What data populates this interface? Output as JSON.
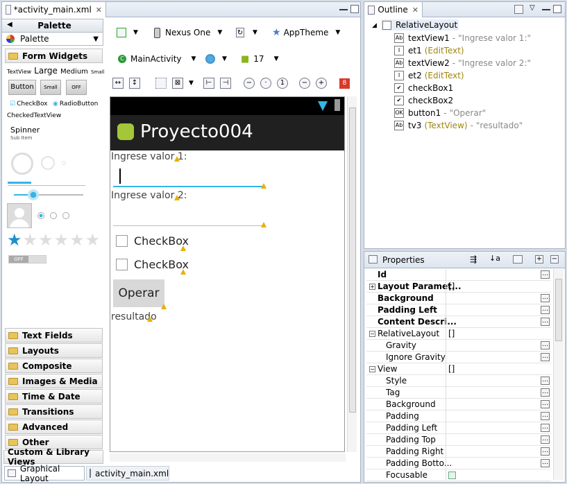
{
  "editor": {
    "tab_title": "*activity_main.xml",
    "bottom_tabs": [
      "Graphical Layout",
      "activity_main.xml"
    ]
  },
  "palette": {
    "header": "Palette",
    "dropdown": "Palette",
    "section": "Form Widgets",
    "tv_sizes": [
      "TextView",
      "Large",
      "Medium",
      "Small"
    ],
    "buttons": [
      "Button",
      "Small",
      "OFF"
    ],
    "check": "CheckBox",
    "radio": "RadioButton",
    "checked_tv": "CheckedTextView",
    "spinner": "Spinner",
    "spinner_sub": "Sub Item",
    "switch": "OFF",
    "categories": [
      "Text Fields",
      "Layouts",
      "Composite",
      "Images & Media",
      "Time & Date",
      "Transitions",
      "Advanced",
      "Other"
    ],
    "custom": "Custom & Library Views"
  },
  "toolbar": {
    "device": "Nexus One",
    "theme": "AppTheme",
    "activity": "MainActivity",
    "api": "17",
    "error_count": "8"
  },
  "app": {
    "title": "Proyecto004",
    "label1": "Ingrese valor 1:",
    "label2": "Ingrese valor 2:",
    "check1": "CheckBox",
    "check2": "CheckBox",
    "button": "Operar",
    "result": "resultado"
  },
  "outline": {
    "title": "Outline",
    "root": "RelativeLayout",
    "items": [
      {
        "icon": "Ab",
        "name": "textView1",
        "type": "",
        "value": "\"Ingrese valor 1:\""
      },
      {
        "icon": "I",
        "name": "et1",
        "type": "(EditText)",
        "value": ""
      },
      {
        "icon": "Ab",
        "name": "textView2",
        "type": "",
        "value": "\"Ingrese valor 2:\""
      },
      {
        "icon": "I",
        "name": "et2",
        "type": "(EditText)",
        "value": ""
      },
      {
        "icon": "✔",
        "name": "checkBox1",
        "type": "",
        "value": ""
      },
      {
        "icon": "✔",
        "name": "checkBox2",
        "type": "",
        "value": ""
      },
      {
        "icon": "OK",
        "name": "button1",
        "type": "",
        "value": "\"Operar\""
      },
      {
        "icon": "Ab",
        "name": "tv3",
        "type": "(TextView)",
        "value": "\"resultado\""
      }
    ]
  },
  "properties": {
    "title": "Properties",
    "rows": [
      {
        "name": "Id",
        "bold": true,
        "value": "",
        "dots": true
      },
      {
        "name": "Layout Paramet...",
        "bold": true,
        "value": "[]",
        "expand": "+"
      },
      {
        "name": "Background",
        "bold": true,
        "value": "",
        "dots": true
      },
      {
        "name": "Padding Left",
        "bold": true,
        "value": "",
        "dots": true
      },
      {
        "name": "Content Descri...",
        "bold": true,
        "value": "",
        "dots": true
      },
      {
        "name": "RelativeLayout",
        "bold": false,
        "value": "[]",
        "expand": "−"
      },
      {
        "name": "Gravity",
        "bold": false,
        "value": "",
        "dots": true,
        "indent": true
      },
      {
        "name": "Ignore Gravity",
        "bold": false,
        "value": "",
        "dots": true,
        "indent": true
      },
      {
        "name": "View",
        "bold": false,
        "value": "[]",
        "expand": "−"
      },
      {
        "name": "Style",
        "bold": false,
        "value": "",
        "dots": true,
        "indent": true
      },
      {
        "name": "Tag",
        "bold": false,
        "value": "",
        "dots": true,
        "indent": true
      },
      {
        "name": "Background",
        "bold": false,
        "value": "",
        "dots": true,
        "indent": true
      },
      {
        "name": "Padding",
        "bold": false,
        "value": "",
        "dots": true,
        "indent": true
      },
      {
        "name": "Padding Left",
        "bold": false,
        "value": "",
        "dots": true,
        "indent": true
      },
      {
        "name": "Padding Top",
        "bold": false,
        "value": "",
        "dots": true,
        "indent": true
      },
      {
        "name": "Padding Right",
        "bold": false,
        "value": "",
        "dots": true,
        "indent": true
      },
      {
        "name": "Padding Botto...",
        "bold": false,
        "value": "",
        "dots": true,
        "indent": true
      },
      {
        "name": "Focusable",
        "bold": false,
        "value": "",
        "check": true,
        "indent": true
      }
    ]
  },
  "colors": {
    "actionbar": "#202020",
    "accent": "#33b5e5",
    "warn": "#e8b000",
    "star": "#1e90c8"
  }
}
